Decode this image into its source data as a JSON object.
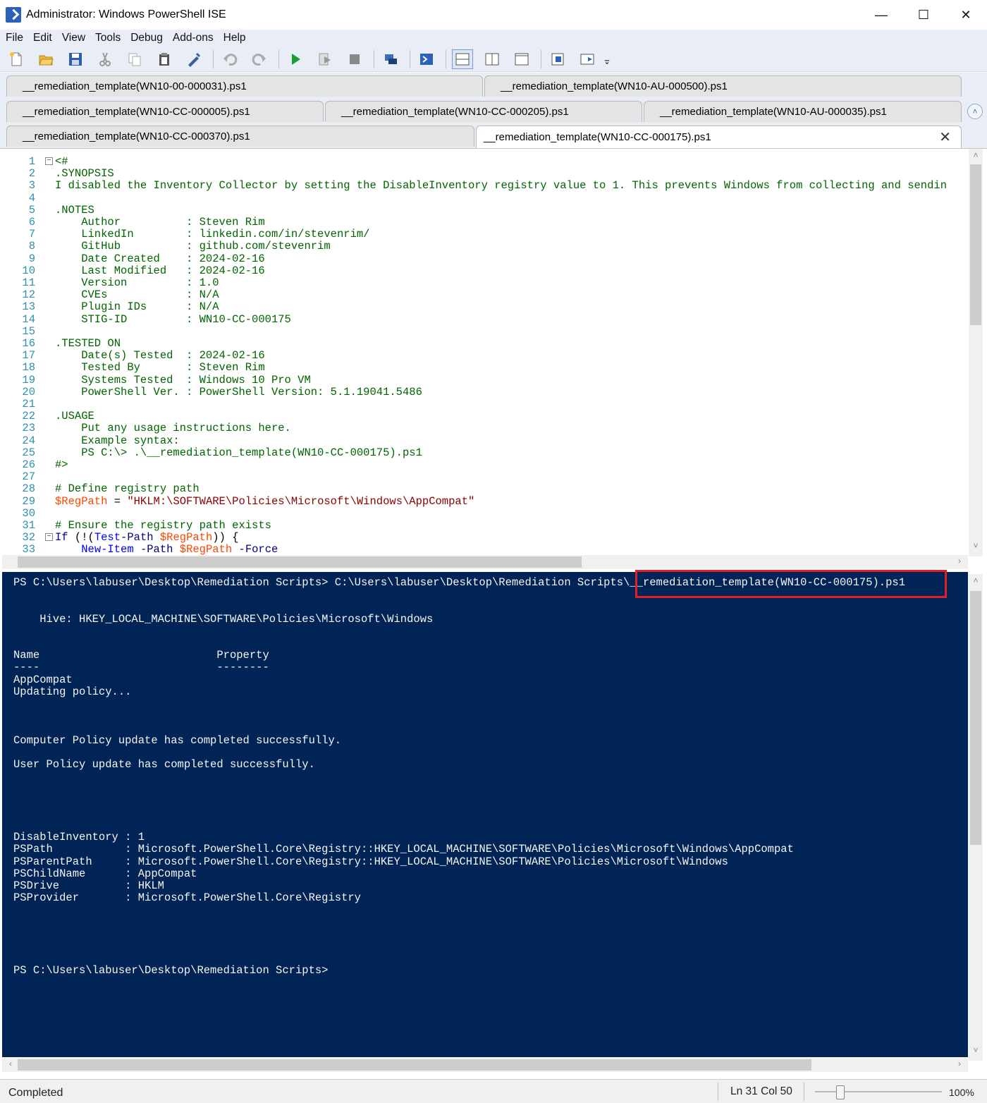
{
  "window": {
    "title": "Administrator: Windows PowerShell ISE",
    "minimize": "—",
    "maximize": "☐",
    "close": "✕"
  },
  "menu": [
    "File",
    "Edit",
    "View",
    "Tools",
    "Debug",
    "Add-ons",
    "Help"
  ],
  "toolbar": {
    "icons": [
      "new-file-icon",
      "open-folder-icon",
      "save-icon",
      "cut-icon",
      "copy-icon",
      "paste-icon",
      "clear-console-icon",
      "undo-icon",
      "redo-icon",
      "run-script-icon",
      "run-selection-icon",
      "stop-icon",
      "remote-powershell-icon",
      "powershell-console-icon",
      "show-script-top-icon",
      "show-script-right-icon",
      "show-script-maximized-icon",
      "show-command-window-icon",
      "show-command-addon-icon",
      "overflow-icon"
    ]
  },
  "tabs": {
    "row1": [
      "__remediation_template(WN10-00-000031).ps1",
      "__remediation_template(WN10-AU-000500).ps1"
    ],
    "row2": [
      "__remediation_template(WN10-CC-000005).ps1",
      "__remediation_template(WN10-CC-000205).ps1",
      "__remediation_template(WN10-AU-000035).ps1"
    ],
    "row3": [
      "__remediation_template(WN10-CC-000370).ps1",
      "__remediation_template(WN10-CC-000175).ps1"
    ],
    "active": "__remediation_template(WN10-CC-000175).ps1",
    "close_glyph": "✕"
  },
  "editor": {
    "line_numbers": [
      "1",
      "2",
      "3",
      "4",
      "5",
      "6",
      "7",
      "8",
      "9",
      "10",
      "11",
      "12",
      "13",
      "14",
      "15",
      "16",
      "17",
      "18",
      "19",
      "20",
      "21",
      "22",
      "23",
      "24",
      "25",
      "26",
      "27",
      "28",
      "29",
      "30",
      "31",
      "32",
      "33"
    ],
    "lines": [
      "<#",
      ".SYNOPSIS",
      "I disabled the Inventory Collector by setting the DisableInventory registry value to 1. This prevents Windows from collecting and sendin",
      "",
      ".NOTES",
      "    Author          : Steven Rim",
      "    LinkedIn        : linkedin.com/in/stevenrim/",
      "    GitHub          : github.com/stevenrim",
      "    Date Created    : 2024-02-16",
      "    Last Modified   : 2024-02-16",
      "    Version         : 1.0",
      "    CVEs            : N/A",
      "    Plugin IDs      : N/A",
      "    STIG-ID         : WN10-CC-000175",
      "",
      ".TESTED ON",
      "    Date(s) Tested  : 2024-02-16",
      "    Tested By       : Steven Rim",
      "    Systems Tested  : Windows 10 Pro VM",
      "    PowerShell Ver. : PowerShell Version: 5.1.19041.5486",
      "",
      ".USAGE",
      "    Put any usage instructions here.",
      "    Example syntax:",
      "    PS C:\\> .\\__remediation_template(WN10-CC-000175).ps1",
      "#>",
      "",
      "# Define registry path",
      "$RegPath = \"HKLM:\\SOFTWARE\\Policies\\Microsoft\\Windows\\AppCompat\"",
      "",
      "# Ensure the registry path exists",
      "If (!(Test-Path $RegPath)) {",
      "    New-Item -Path $RegPath -Force"
    ],
    "fold_markers": {
      "minus": "−"
    }
  },
  "console": {
    "lines": [
      "PS C:\\Users\\labuser\\Desktop\\Remediation Scripts> C:\\Users\\labuser\\Desktop\\Remediation Scripts\\__remediation_template(WN10-CC-000175).ps1",
      "",
      "",
      "    Hive: HKEY_LOCAL_MACHINE\\SOFTWARE\\Policies\\Microsoft\\Windows",
      "",
      "",
      "Name                           Property",
      "----                           --------",
      "AppCompat",
      "Updating policy...",
      "",
      "",
      "",
      "Computer Policy update has completed successfully.",
      "",
      "User Policy update has completed successfully.",
      "",
      "",
      "",
      "",
      "",
      "DisableInventory : 1",
      "PSPath           : Microsoft.PowerShell.Core\\Registry::HKEY_LOCAL_MACHINE\\SOFTWARE\\Policies\\Microsoft\\Windows\\AppCompat",
      "PSParentPath     : Microsoft.PowerShell.Core\\Registry::HKEY_LOCAL_MACHINE\\SOFTWARE\\Policies\\Microsoft\\Windows",
      "PSChildName      : AppCompat",
      "PSDrive          : HKLM",
      "PSProvider       : Microsoft.PowerShell.Core\\Registry",
      "",
      "",
      "",
      "",
      "",
      "PS C:\\Users\\labuser\\Desktop\\Remediation Scripts>"
    ]
  },
  "status": {
    "state": "Completed",
    "position": "Ln 31  Col 50",
    "zoom": "100%",
    "zoom_level": 0.2
  },
  "colors": {
    "console_bg": "#012456",
    "highlight": "#e11f26",
    "comment": "#006400",
    "variable": "#ff4500",
    "string": "#8b0000",
    "command": "#0000ff"
  },
  "scroll": {
    "up": "˄",
    "down": "˅",
    "left": "‹",
    "right": "›"
  }
}
